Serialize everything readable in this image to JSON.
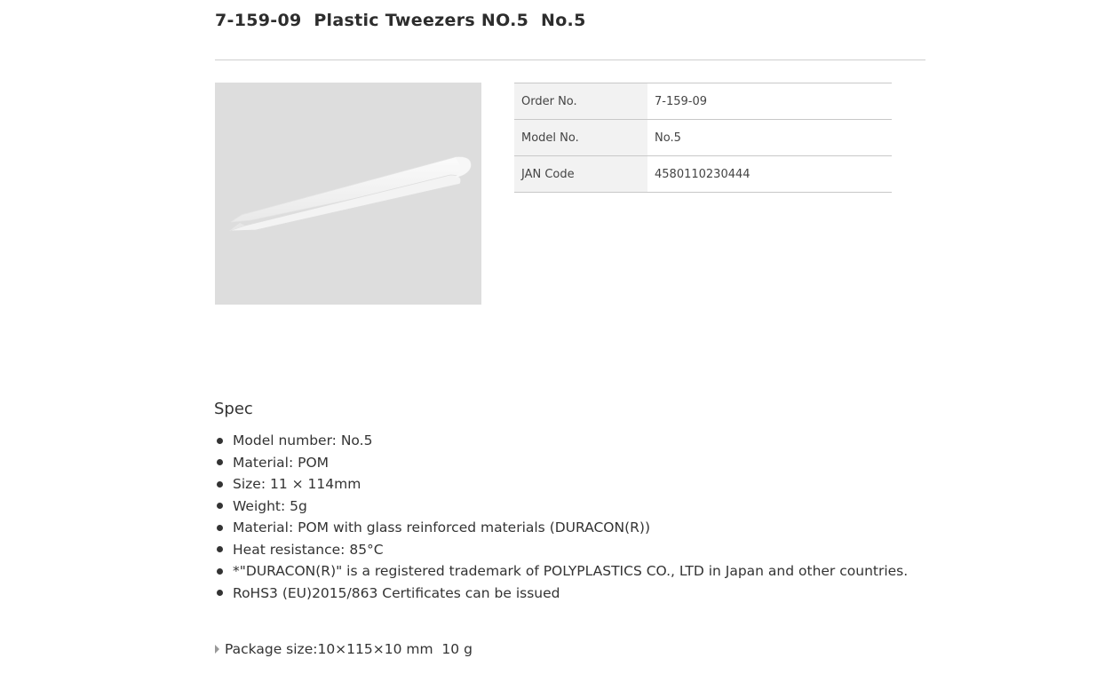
{
  "header": {
    "title": "7-159-09  Plastic Tweezers NO.5  No.5"
  },
  "product_image": {
    "icon": "tweezers-photo",
    "background_color": "#dddddd"
  },
  "details_table": [
    {
      "key": "Order No.",
      "value": "7-159-09"
    },
    {
      "key": "Model No.",
      "value": "No.5"
    },
    {
      "key": "JAN Code",
      "value": "4580110230444"
    }
  ],
  "spec": {
    "heading": "Spec",
    "items": [
      "Model number: No.5",
      "Material: POM",
      "Size: 11 × 114mm",
      "Weight: 5g",
      "Material: POM with glass reinforced materials (DURACON(R))",
      "Heat resistance: 85°C",
      "*\"DURACON(R)\" is a registered trademark of POLYPLASTICS CO., LTD in Japan and other countries.",
      "RoHS3 (EU)2015/863 Certificates can be issued"
    ]
  },
  "package": {
    "text": "Package size:10×115×10 mm  10 g"
  }
}
